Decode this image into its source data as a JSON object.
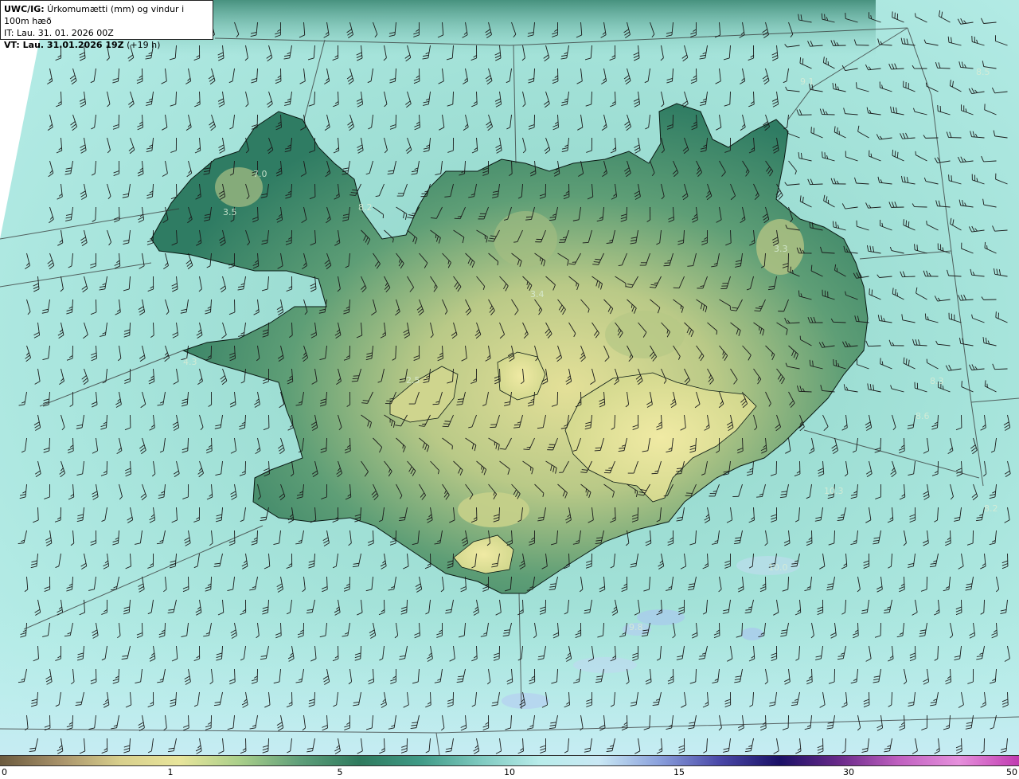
{
  "header": {
    "code": "UWC/IG:",
    "title": " Úrkomumætti (mm) og vindur i 100m hæð",
    "it_line": "IT: Lau. 31. 01. 2026 00Z",
    "vt_label": "VT: Lau. 31.01.2026 19Z",
    "vt_suffix": " (+19 h)"
  },
  "colorbar": {
    "ticks": [
      "0",
      "1",
      "5",
      "10",
      "15",
      "30",
      "50"
    ],
    "colors": [
      "#6b5a3e",
      "#a8926a",
      "#d8cf8c",
      "#e8e59b",
      "#aacf8a",
      "#5f9f7a",
      "#2f7a5e",
      "#3f9a86",
      "#7ec9bf",
      "#b8ecea",
      "#c9e8f4",
      "#8aa0dc",
      "#4a48a8",
      "#1a1066",
      "#6a2a8a",
      "#c060c0",
      "#e690dc",
      "#c03ab0"
    ]
  },
  "value_labels": [
    "7.0",
    "8.2",
    "3.5",
    "4.3",
    "2.5",
    "3.4",
    "3.3",
    "9.1",
    "8.5",
    "8.3",
    "8.6",
    "10.3",
    "10.0",
    "9.8",
    "8.2"
  ],
  "map": {
    "ocean_color": "#9fded6",
    "land_low_color": "#2f8068",
    "land_high_color": "#e6e399"
  }
}
